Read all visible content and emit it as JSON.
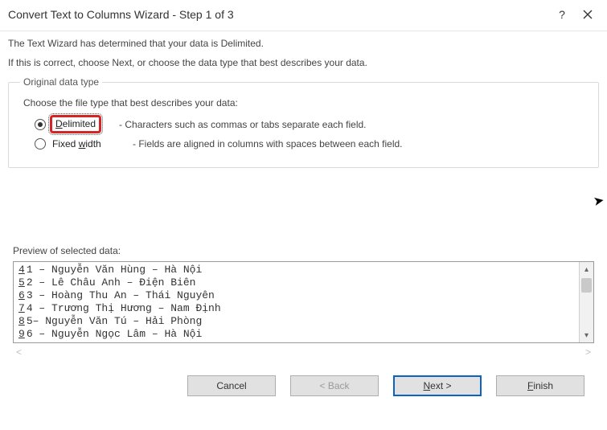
{
  "titlebar": {
    "title": "Convert Text to Columns Wizard - Step 1 of 3",
    "help_label": "?",
    "close_label": "×"
  },
  "intro": {
    "line1": "The Text Wizard has determined that your data is Delimited.",
    "line2": "If this is correct, choose Next, or choose the data type that best describes your data."
  },
  "group": {
    "legend": "Original data type",
    "choose": "Choose the file type that best describes your data:",
    "options": [
      {
        "id": "delimited",
        "label_pre": "D",
        "label_rest": "elimited",
        "selected": true,
        "desc": "- Characters such as commas or tabs separate each field."
      },
      {
        "id": "fixedwidth",
        "label_pre": "Fixed ",
        "label_u": "w",
        "label_rest": "idth",
        "selected": false,
        "desc": "- Fields are aligned in columns with spaces between each field."
      }
    ]
  },
  "preview": {
    "label": "Preview of selected data:",
    "rows": [
      {
        "n": "4",
        "text": "1 – Nguyễn Văn Hùng – Hà Nội"
      },
      {
        "n": "5",
        "text": "2 – Lê Châu Anh – Điện Biên"
      },
      {
        "n": "6",
        "text": "3 – Hoàng Thu An – Thái Nguyên"
      },
      {
        "n": "7",
        "text": "4 – Trương Thị Hương – Nam Định"
      },
      {
        "n": "8",
        "text": "5– Nguyễn Văn Tú – Hải Phòng"
      },
      {
        "n": "9",
        "text": "6 – Nguyễn Ngọc Lâm – Hà Nội"
      }
    ]
  },
  "buttons": {
    "cancel": "Cancel",
    "back": "< Back",
    "next_u": "N",
    "next_rest": "ext >",
    "finish_u": "F",
    "finish_rest": "inish"
  }
}
